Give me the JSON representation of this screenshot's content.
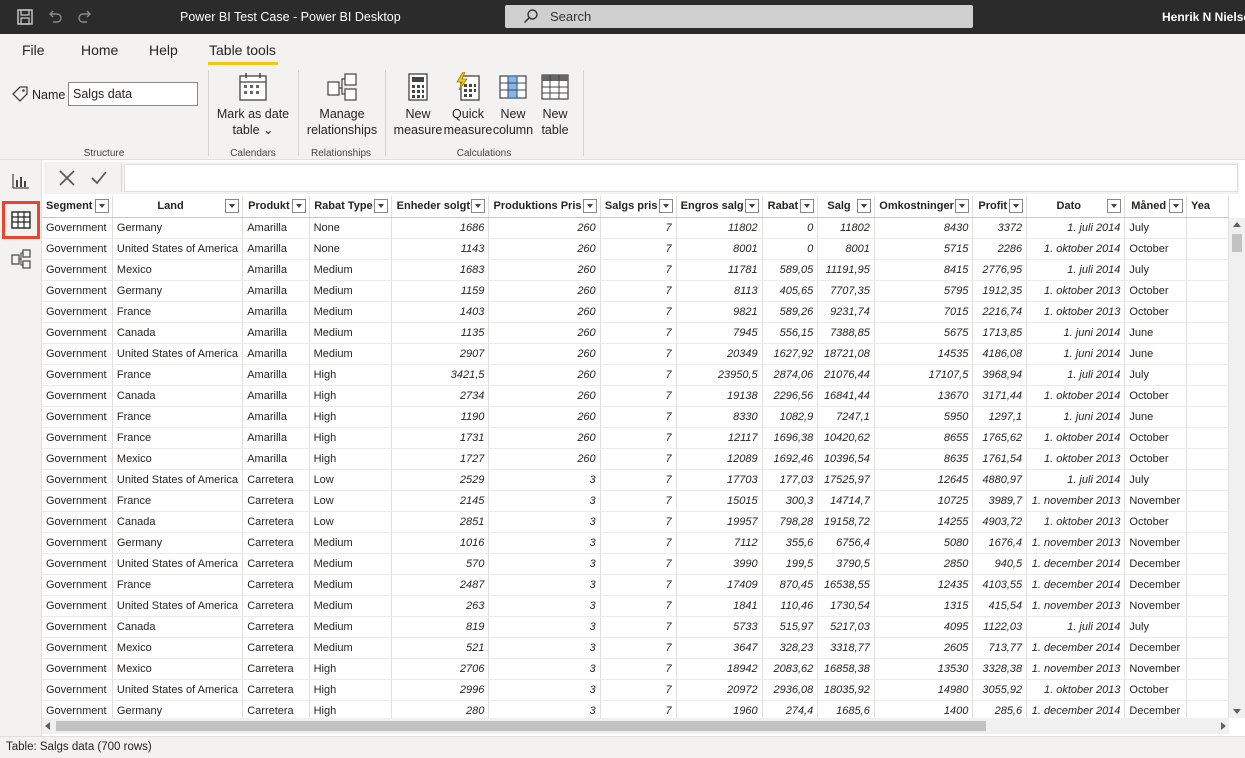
{
  "titlebar": {
    "title": "Power BI Test Case - Power BI Desktop",
    "search_label": "Search",
    "user": "Henrik N Nielse"
  },
  "tabs": [
    {
      "label": "File"
    },
    {
      "label": "Home"
    },
    {
      "label": "Help"
    },
    {
      "label": "Table tools",
      "active": true
    }
  ],
  "ribbon": {
    "name_label": "Name",
    "name_value": "Salgs data",
    "groups": {
      "structure": "Structure",
      "calendars": "Calendars",
      "relationships": "Relationships",
      "calculations": "Calculations"
    },
    "buttons": {
      "mark_date_1": "Mark as date",
      "mark_date_2": "table",
      "manage_rel_1": "Manage",
      "manage_rel_2": "relationships",
      "new_measure_1": "New",
      "new_measure_2": "measure",
      "quick_measure_1": "Quick",
      "quick_measure_2": "measure",
      "new_column_1": "New",
      "new_column_2": "column",
      "new_table_1": "New",
      "new_table_2": "table"
    }
  },
  "table": {
    "columns": [
      "Segment",
      "Land",
      "Produkt",
      "Rabat Type",
      "Enheder solgt",
      "Produktions Pris",
      "Salgs pris",
      "Engros salg",
      "Rabat",
      "Salg",
      "Omkostninger",
      "Profit",
      "Dato",
      "Måned",
      "Yea"
    ],
    "rows": [
      [
        "Government",
        "Germany",
        "Amarilla",
        "None",
        "1686",
        "260",
        "7",
        "11802",
        "0",
        "11802",
        "8430",
        "3372",
        "1. juli 2014",
        "July"
      ],
      [
        "Government",
        "United States of America",
        "Amarilla",
        "None",
        "1143",
        "260",
        "7",
        "8001",
        "0",
        "8001",
        "5715",
        "2286",
        "1. oktober 2014",
        "October"
      ],
      [
        "Government",
        "Mexico",
        "Amarilla",
        "Medium",
        "1683",
        "260",
        "7",
        "11781",
        "589,05",
        "11191,95",
        "8415",
        "2776,95",
        "1. juli 2014",
        "July"
      ],
      [
        "Government",
        "Germany",
        "Amarilla",
        "Medium",
        "1159",
        "260",
        "7",
        "8113",
        "405,65",
        "7707,35",
        "5795",
        "1912,35",
        "1. oktober 2013",
        "October"
      ],
      [
        "Government",
        "France",
        "Amarilla",
        "Medium",
        "1403",
        "260",
        "7",
        "9821",
        "589,26",
        "9231,74",
        "7015",
        "2216,74",
        "1. oktober 2013",
        "October"
      ],
      [
        "Government",
        "Canada",
        "Amarilla",
        "Medium",
        "1135",
        "260",
        "7",
        "7945",
        "556,15",
        "7388,85",
        "5675",
        "1713,85",
        "1. juni 2014",
        "June"
      ],
      [
        "Government",
        "United States of America",
        "Amarilla",
        "Medium",
        "2907",
        "260",
        "7",
        "20349",
        "1627,92",
        "18721,08",
        "14535",
        "4186,08",
        "1. juni 2014",
        "June"
      ],
      [
        "Government",
        "France",
        "Amarilla",
        "High",
        "3421,5",
        "260",
        "7",
        "23950,5",
        "2874,06",
        "21076,44",
        "17107,5",
        "3968,94",
        "1. juli 2014",
        "July"
      ],
      [
        "Government",
        "Canada",
        "Amarilla",
        "High",
        "2734",
        "260",
        "7",
        "19138",
        "2296,56",
        "16841,44",
        "13670",
        "3171,44",
        "1. oktober 2014",
        "October"
      ],
      [
        "Government",
        "France",
        "Amarilla",
        "High",
        "1190",
        "260",
        "7",
        "8330",
        "1082,9",
        "7247,1",
        "5950",
        "1297,1",
        "1. juni 2014",
        "June"
      ],
      [
        "Government",
        "France",
        "Amarilla",
        "High",
        "1731",
        "260",
        "7",
        "12117",
        "1696,38",
        "10420,62",
        "8655",
        "1765,62",
        "1. oktober 2014",
        "October"
      ],
      [
        "Government",
        "Mexico",
        "Amarilla",
        "High",
        "1727",
        "260",
        "7",
        "12089",
        "1692,46",
        "10396,54",
        "8635",
        "1761,54",
        "1. oktober 2013",
        "October"
      ],
      [
        "Government",
        "United States of America",
        "Carretera",
        "Low",
        "2529",
        "3",
        "7",
        "17703",
        "177,03",
        "17525,97",
        "12645",
        "4880,97",
        "1. juli 2014",
        "July"
      ],
      [
        "Government",
        "France",
        "Carretera",
        "Low",
        "2145",
        "3",
        "7",
        "15015",
        "300,3",
        "14714,7",
        "10725",
        "3989,7",
        "1. november 2013",
        "November"
      ],
      [
        "Government",
        "Canada",
        "Carretera",
        "Low",
        "2851",
        "3",
        "7",
        "19957",
        "798,28",
        "19158,72",
        "14255",
        "4903,72",
        "1. oktober 2013",
        "October"
      ],
      [
        "Government",
        "Germany",
        "Carretera",
        "Medium",
        "1016",
        "3",
        "7",
        "7112",
        "355,6",
        "6756,4",
        "5080",
        "1676,4",
        "1. november 2013",
        "November"
      ],
      [
        "Government",
        "United States of America",
        "Carretera",
        "Medium",
        "570",
        "3",
        "7",
        "3990",
        "199,5",
        "3790,5",
        "2850",
        "940,5",
        "1. december 2014",
        "December"
      ],
      [
        "Government",
        "France",
        "Carretera",
        "Medium",
        "2487",
        "3",
        "7",
        "17409",
        "870,45",
        "16538,55",
        "12435",
        "4103,55",
        "1. december 2014",
        "December"
      ],
      [
        "Government",
        "United States of America",
        "Carretera",
        "Medium",
        "263",
        "3",
        "7",
        "1841",
        "110,46",
        "1730,54",
        "1315",
        "415,54",
        "1. november 2013",
        "November"
      ],
      [
        "Government",
        "Canada",
        "Carretera",
        "Medium",
        "819",
        "3",
        "7",
        "5733",
        "515,97",
        "5217,03",
        "4095",
        "1122,03",
        "1. juli 2014",
        "July"
      ],
      [
        "Government",
        "Mexico",
        "Carretera",
        "Medium",
        "521",
        "3",
        "7",
        "3647",
        "328,23",
        "3318,77",
        "2605",
        "713,77",
        "1. december 2014",
        "December"
      ],
      [
        "Government",
        "Mexico",
        "Carretera",
        "High",
        "2706",
        "3",
        "7",
        "18942",
        "2083,62",
        "16858,38",
        "13530",
        "3328,38",
        "1. november 2013",
        "November"
      ],
      [
        "Government",
        "United States of America",
        "Carretera",
        "High",
        "2996",
        "3",
        "7",
        "20972",
        "2936,08",
        "18035,92",
        "14980",
        "3055,92",
        "1. oktober 2013",
        "October"
      ],
      [
        "Government",
        "Germany",
        "Carretera",
        "High",
        "280",
        "3",
        "7",
        "1960",
        "274,4",
        "1685,6",
        "1400",
        "285,6",
        "1. december 2014",
        "December"
      ]
    ]
  },
  "status": {
    "text": "Table: Salgs data (700 rows)"
  }
}
